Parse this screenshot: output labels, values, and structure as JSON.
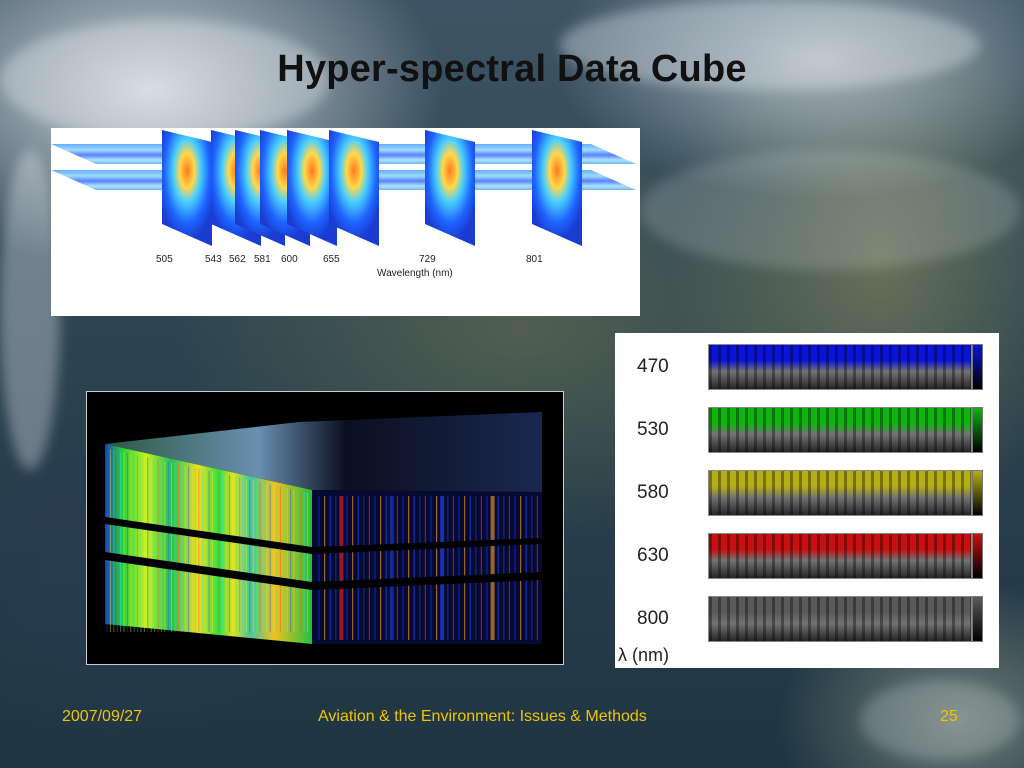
{
  "slide": {
    "title": "Hyper-spectral Data Cube",
    "footer_date": "2007/09/27",
    "footer_center": "Aviation & the Environment: Issues & Methods",
    "page_number": "25"
  },
  "spectral_panel": {
    "wavelengths": [
      "505",
      "543",
      "562",
      "581",
      "600",
      "655",
      "729",
      "801"
    ],
    "axis_label": "Wavelength (nm)"
  },
  "band_panel": {
    "bands": [
      {
        "label": "470",
        "color": "#0a14d8"
      },
      {
        "label": "530",
        "color": "#0fb40f"
      },
      {
        "label": "580",
        "color": "#b5ae16"
      },
      {
        "label": "630",
        "color": "#c81010"
      },
      {
        "label": "800",
        "color": "#5a5a5a"
      }
    ],
    "unit_label": "λ (nm)"
  },
  "colors": {
    "footer_text": "#f2c400",
    "title_text": "#111111"
  }
}
